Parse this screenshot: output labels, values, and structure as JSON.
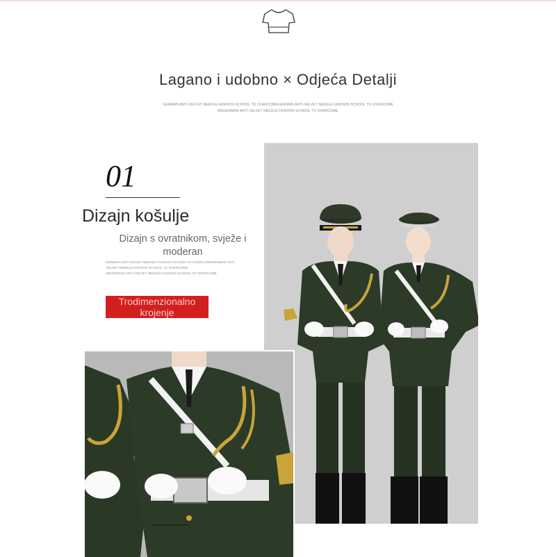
{
  "header": {
    "icon": "shirt-icon",
    "headline": "Lagano i udobno × Odjeća Detalji",
    "sub_line_1": "GERMAN ANTI-VELVET NEEDLE FASHION SCHOOL TO OVERCOMEGERMAN ANTI-VELVET NEEDLE FASHION SCHOOL TO OVERCOME",
    "sub_line_2": "MEGERMAN ANTI-VELVET NEEDLE FASHION SCHOOL TO OVERCOME"
  },
  "section": {
    "number": "01",
    "title": "Dizajn košulje",
    "description": "Dizajn s ovratnikom, svježe i moderan",
    "tiny_1": "GERMAN ANTI-VELVET NEEDLE FASHION SCHOOL TO OVERCOMEGERMAN ANTI-",
    "tiny_2": "VELVET NEEDLE FASHION SCHOOL TO OVERCOME",
    "tiny_3": "MEGERMAN ANTI-VELVET NEEDLE FASHION SCHOOL TO OVERCOME",
    "badge": "Trodimenzionalno krojenje"
  },
  "colors": {
    "uniform": "#2c3a28",
    "badge": "#d41f1f",
    "photo_bg": "#cfcfcf",
    "braid": "#c9a43a"
  }
}
